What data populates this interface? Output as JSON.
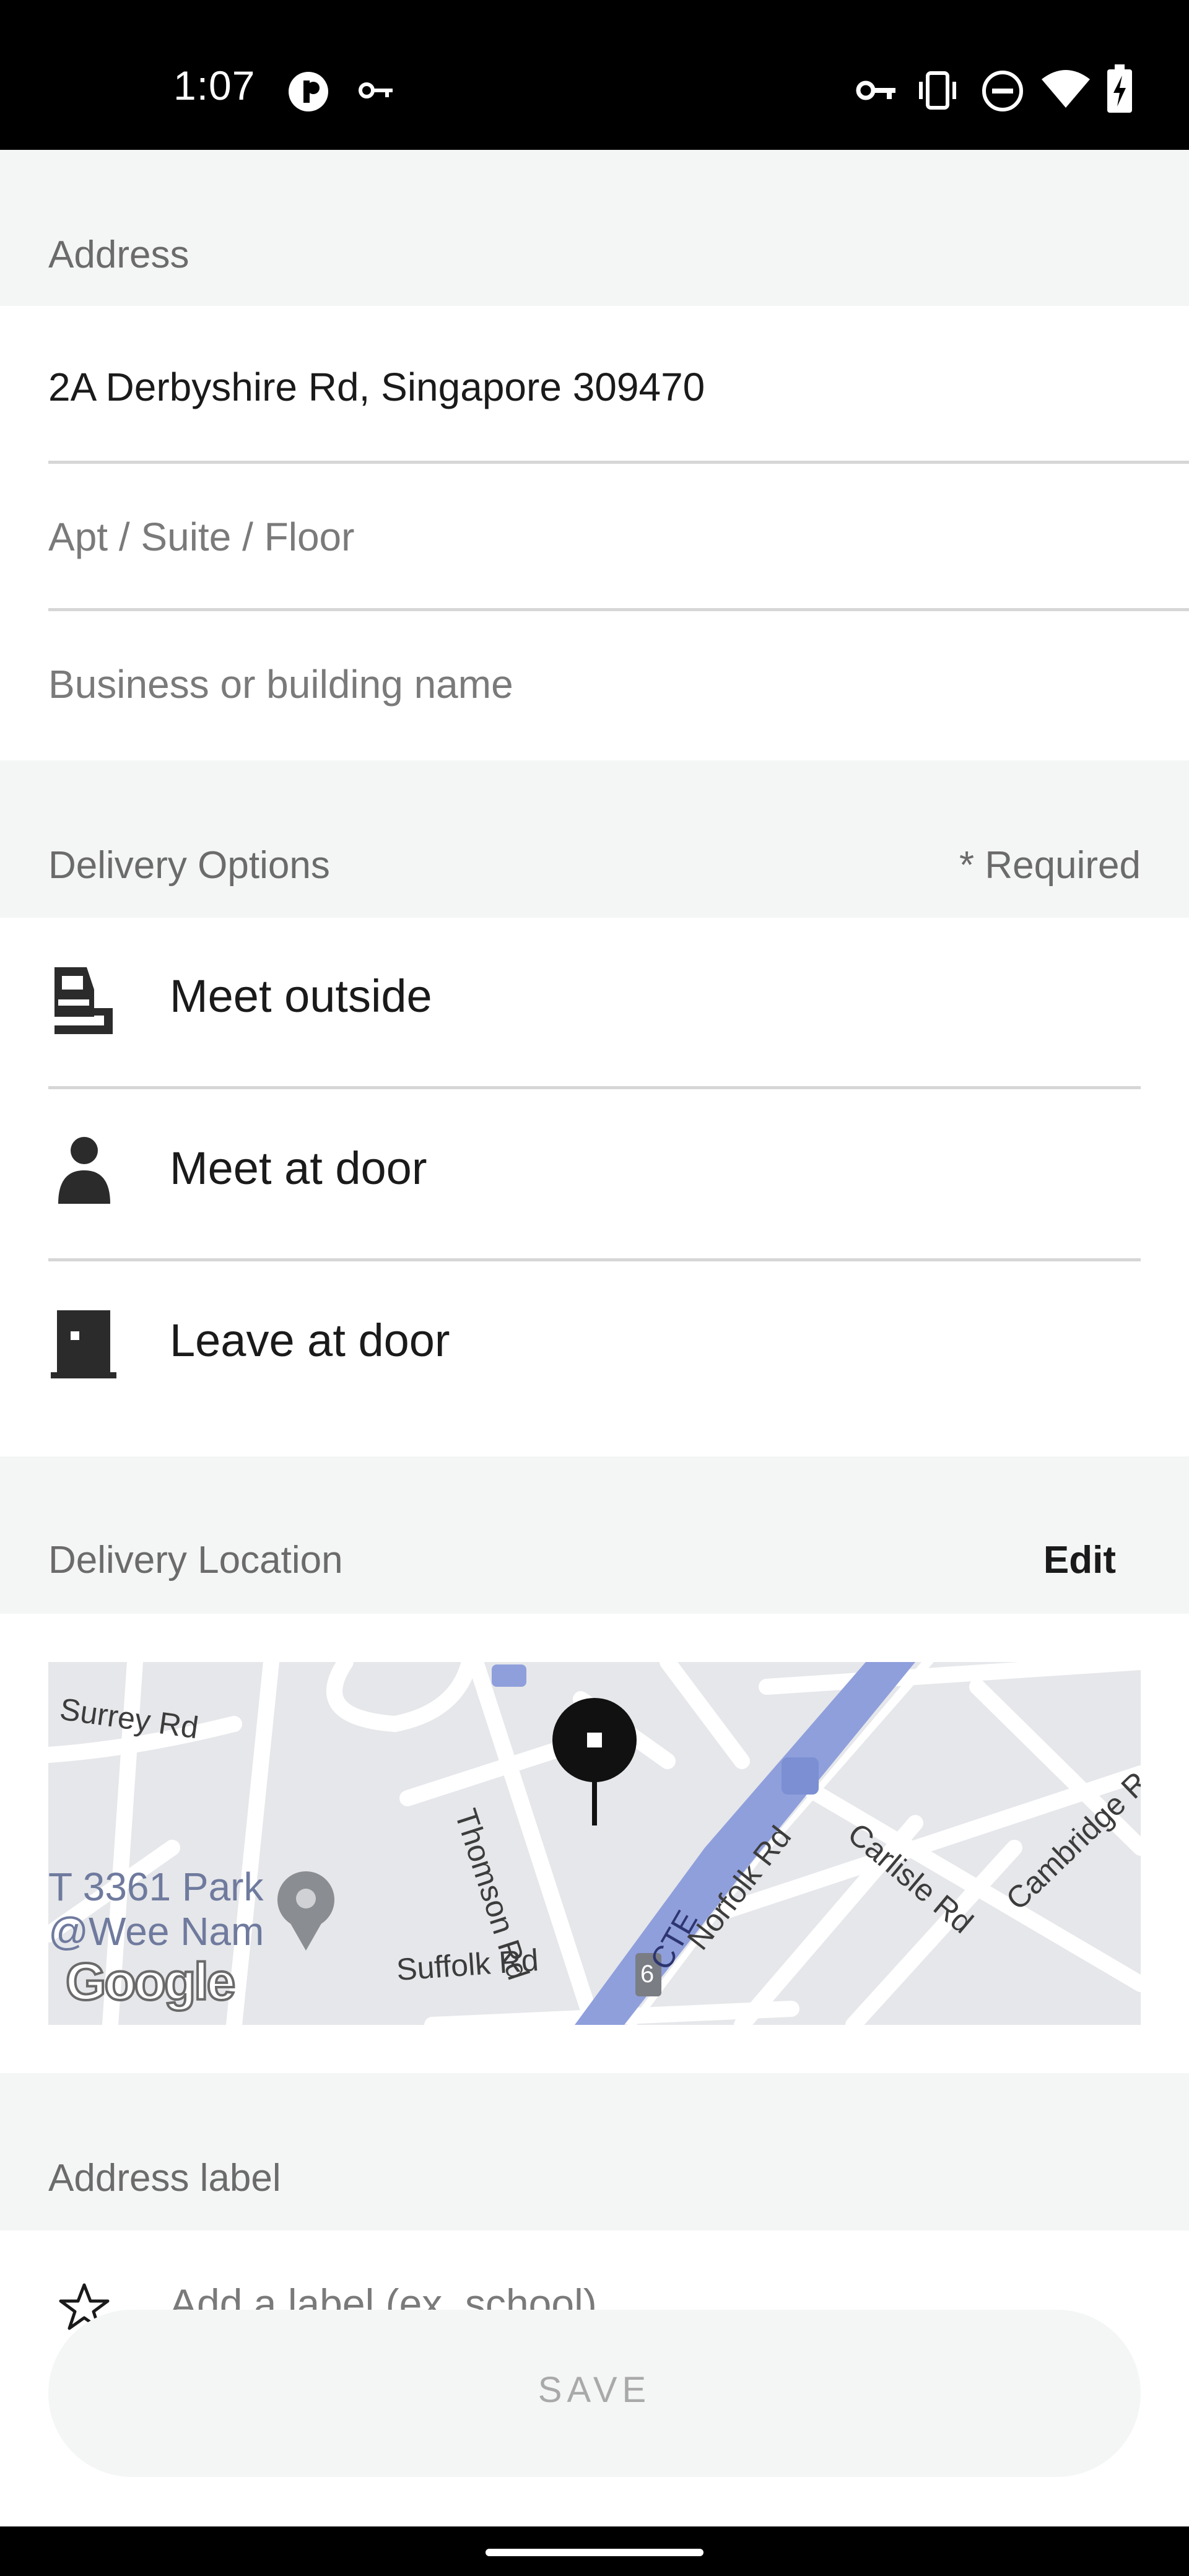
{
  "status_bar": {
    "time": "1:07",
    "icons": [
      "pi-hole-icon",
      "key-icon",
      "vpn-key-icon",
      "vibrate-icon",
      "do-not-disturb-icon",
      "wifi-icon",
      "battery-charging-icon"
    ]
  },
  "address": {
    "header": "Address",
    "street": "2A Derbyshire Rd, Singapore 309470",
    "apt_placeholder": "Apt / Suite / Floor",
    "business_placeholder": "Business or building name"
  },
  "delivery_options": {
    "header": "Delivery Options",
    "required_label": "* Required",
    "options": [
      {
        "label": "Meet outside",
        "icon": "car-icon"
      },
      {
        "label": "Meet at door",
        "icon": "person-icon"
      },
      {
        "label": "Leave at door",
        "icon": "door-icon"
      }
    ]
  },
  "delivery_location": {
    "header": "Delivery Location",
    "edit_label": "Edit",
    "map_labels": {
      "surrey": "Surrey Rd",
      "thomson": "Thomson Rd",
      "park_line1": "T 3361 Park",
      "park_line2": "@Wee Nam",
      "suffolk": "Suffolk Rd",
      "cte": "CTE",
      "norfolk": "Norfolk Rd",
      "carlisle": "Carlisle Rd",
      "cambridge": "Cambridge Rd",
      "route": "6",
      "google": "Google"
    },
    "colors": {
      "expressway": "#8f9fdc",
      "map_bg": "#e6e7ea"
    }
  },
  "address_label": {
    "header": "Address label",
    "placeholder": "Add a label (ex. school)"
  },
  "save_button": {
    "label": "SAVE"
  }
}
